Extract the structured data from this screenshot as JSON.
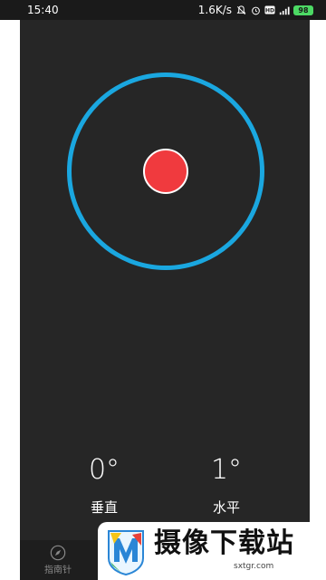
{
  "status_bar": {
    "time": "15:40",
    "speed": "1.6K/s",
    "battery": "98",
    "icons": [
      "mute-icon",
      "alarm-icon",
      "hd-icon",
      "signal-icon",
      "battery-icon"
    ]
  },
  "level": {
    "ring_color": "#1aa7e0",
    "bubble_color": "#f03a3e"
  },
  "readings": {
    "vertical": {
      "value": "0°",
      "label": "垂直"
    },
    "horizontal": {
      "value": "1°",
      "label": "水平"
    }
  },
  "bottom_bar": {
    "compass_label": "指南针",
    "compass_icon": "compass-icon"
  },
  "watermark": {
    "title": "摄像下载站",
    "url": "sxtgr.com"
  }
}
